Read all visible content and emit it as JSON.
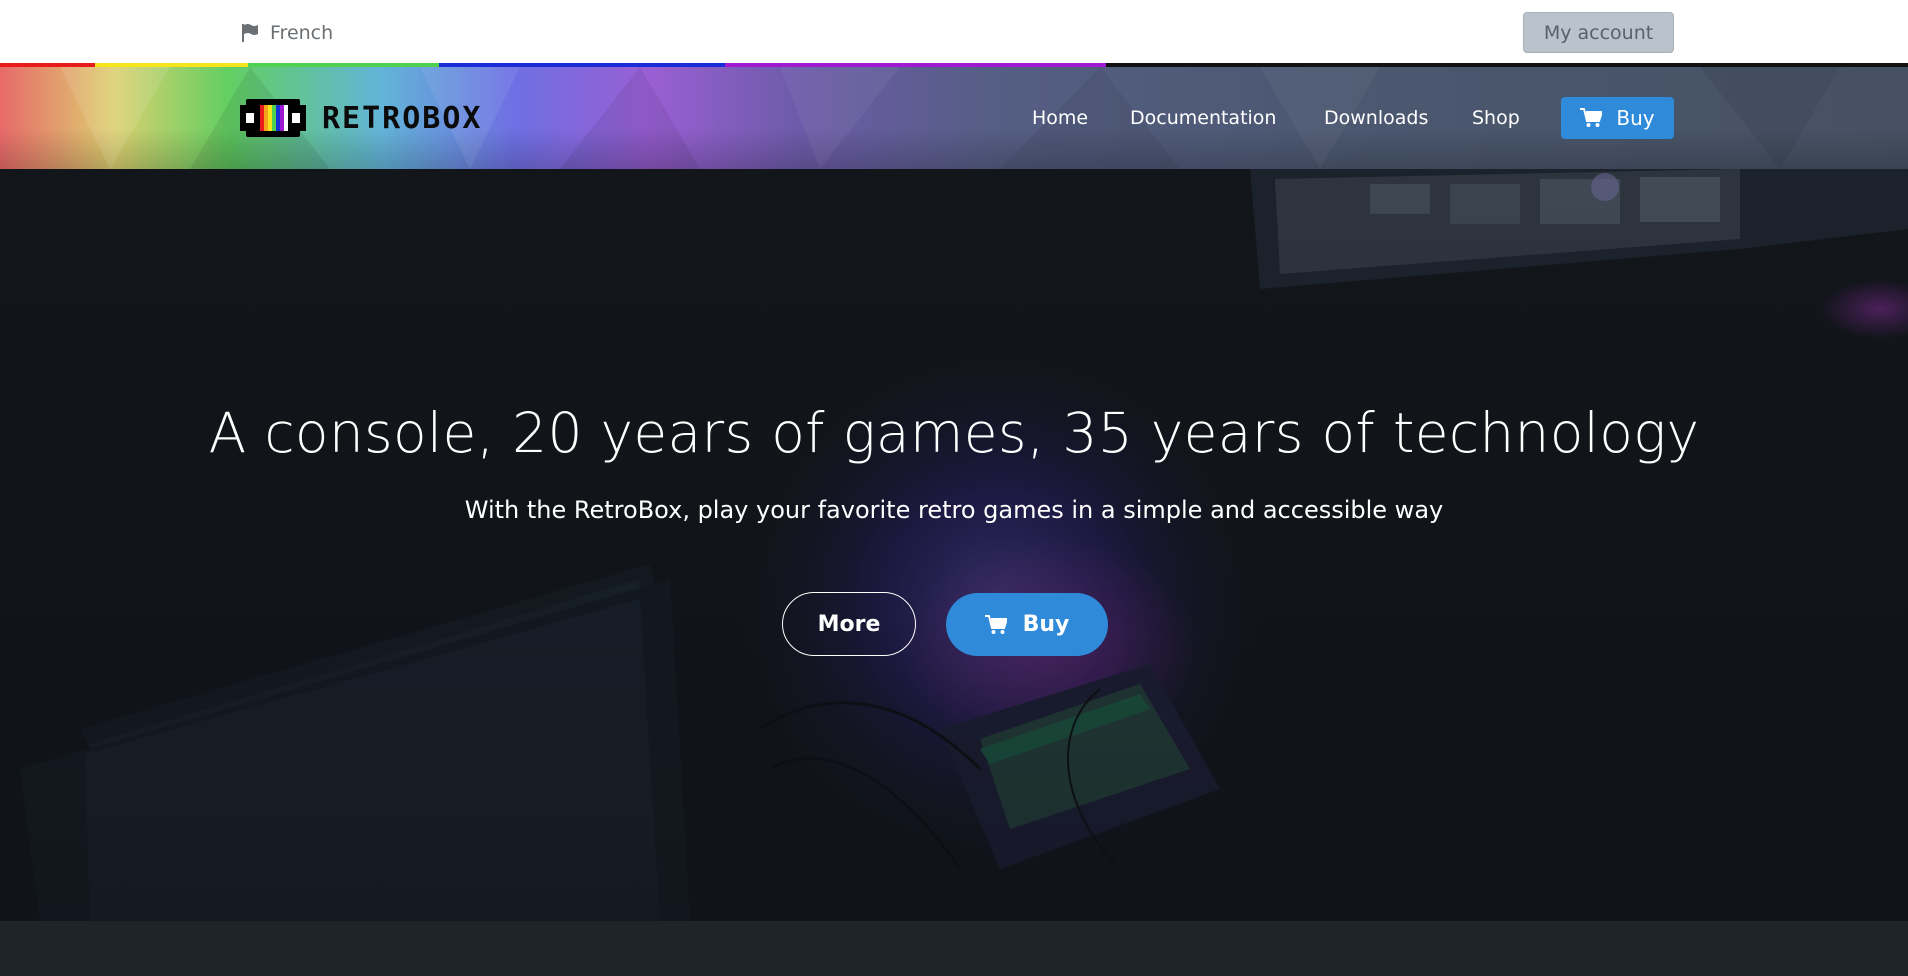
{
  "topbar": {
    "language_label": "French",
    "language_icon": "flag-icon",
    "account_label": "My account"
  },
  "colors": {
    "brand_blue": "#2f8ad9",
    "account_button": "#bac3cc",
    "rainbow": [
      "#e81a1a",
      "#f7e51b",
      "#4fd14f",
      "#1a2cd6",
      "#9d1ad0",
      "#111111"
    ]
  },
  "navbar": {
    "brand": "RETROBOX",
    "links": [
      "Home",
      "Documentation",
      "Downloads",
      "Shop"
    ],
    "buy_label": "Buy",
    "buy_icon": "cart-icon"
  },
  "hero": {
    "title": "A console, 20 years of games, 35 years of technology",
    "subtitle": "With the RetroBox, play your favorite retro games in a simple and accessible way",
    "more_label": "More",
    "buy_label": "Buy",
    "buy_icon": "cart-icon"
  }
}
